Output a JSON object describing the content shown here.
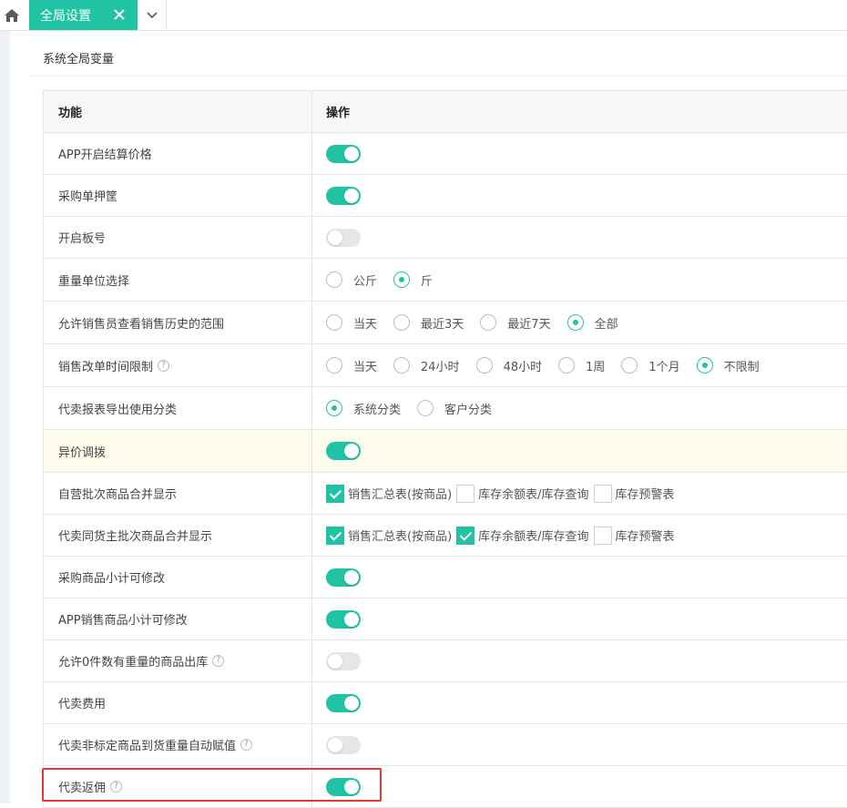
{
  "tabs": {
    "home_icon": "home-icon",
    "active_label": "全局设置",
    "close_icon": "close-icon",
    "dropdown_icon": "chevron-down-icon"
  },
  "section": {
    "title": "系统全局变量"
  },
  "table": {
    "headers": {
      "func": "功能",
      "op": "操作"
    },
    "rows": [
      {
        "label": "APP开启结算价格",
        "type": "switch",
        "on": true
      },
      {
        "label": "采购单押筐",
        "type": "switch",
        "on": true
      },
      {
        "label": "开启板号",
        "type": "switch",
        "on": false
      },
      {
        "label": "重量单位选择",
        "type": "radio",
        "options": [
          "公斤",
          "斤"
        ],
        "selected": "斤"
      },
      {
        "label": "允许销售员查看销售历史的范围",
        "type": "radio",
        "options": [
          "当天",
          "最近3天",
          "最近7天",
          "全部"
        ],
        "selected": "全部"
      },
      {
        "label": "销售改单时间限制",
        "help": "?",
        "type": "radio",
        "options": [
          "当天",
          "24小时",
          "48小时",
          "1周",
          "1个月",
          "不限制"
        ],
        "selected": "不限制"
      },
      {
        "label": "代卖报表导出使用分类",
        "type": "radio",
        "options": [
          "系统分类",
          "客户分类"
        ],
        "selected": "系统分类"
      },
      {
        "label": "异价调拨",
        "type": "switch",
        "on": true,
        "highlighted": true
      },
      {
        "label": "自营批次商品合并显示",
        "type": "checkbox",
        "options": [
          "销售汇总表(按商品)",
          "库存余额表/库存查询",
          "库存预警表"
        ],
        "checked": [
          true,
          false,
          false
        ]
      },
      {
        "label": "代卖同货主批次商品合并显示",
        "type": "checkbox",
        "options": [
          "销售汇总表(按商品)",
          "库存余额表/库存查询",
          "库存预警表"
        ],
        "checked": [
          true,
          true,
          false
        ]
      },
      {
        "label": "采购商品小计可修改",
        "type": "switch",
        "on": true
      },
      {
        "label": "APP销售商品小计可修改",
        "type": "switch",
        "on": true
      },
      {
        "label": "允许0件数有重量的商品出库",
        "help": "?",
        "type": "switch",
        "on": false
      },
      {
        "label": "代卖费用",
        "type": "switch",
        "on": true
      },
      {
        "label": "代卖非标定商品到货重量自动赋值",
        "help": "?",
        "type": "switch",
        "on": false
      },
      {
        "label": "代卖返佣",
        "help": "?",
        "type": "switch",
        "on": true
      }
    ]
  },
  "colors": {
    "accent": "#20c4a4",
    "highlight_row": "#fdfbea",
    "red_frame": "#e53935"
  }
}
